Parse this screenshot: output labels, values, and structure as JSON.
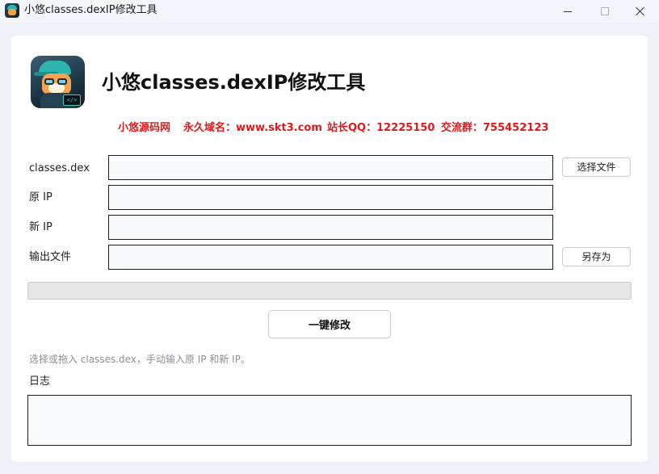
{
  "window": {
    "title": "小悠classes.dexIP修改工具"
  },
  "header": {
    "app_title": "小悠classes.dexIP修改工具",
    "logo_icon": "fox-coder-logo",
    "logo_laptop_text": "</>"
  },
  "info": {
    "site": "小悠源码网",
    "domain": "永久域名：www.skt3.com",
    "qq": "站长QQ：12225150",
    "group": "交流群：755452123",
    "color": "#e0191b"
  },
  "form": {
    "classes_label": "classes.dex",
    "classes_value": "",
    "choose_file_button": "选择文件",
    "orig_ip_label": "原 IP",
    "orig_ip_value": "",
    "new_ip_label": "新 IP",
    "new_ip_value": "",
    "output_label": "输出文件",
    "output_value": "",
    "save_as_button": "另存为"
  },
  "progress": {
    "value": 0
  },
  "actions": {
    "modify_button": "一键修改"
  },
  "hint": "选择或拖入 classes.dex，手动输入原 IP 和新 IP。",
  "log": {
    "label": "日志",
    "content": ""
  }
}
